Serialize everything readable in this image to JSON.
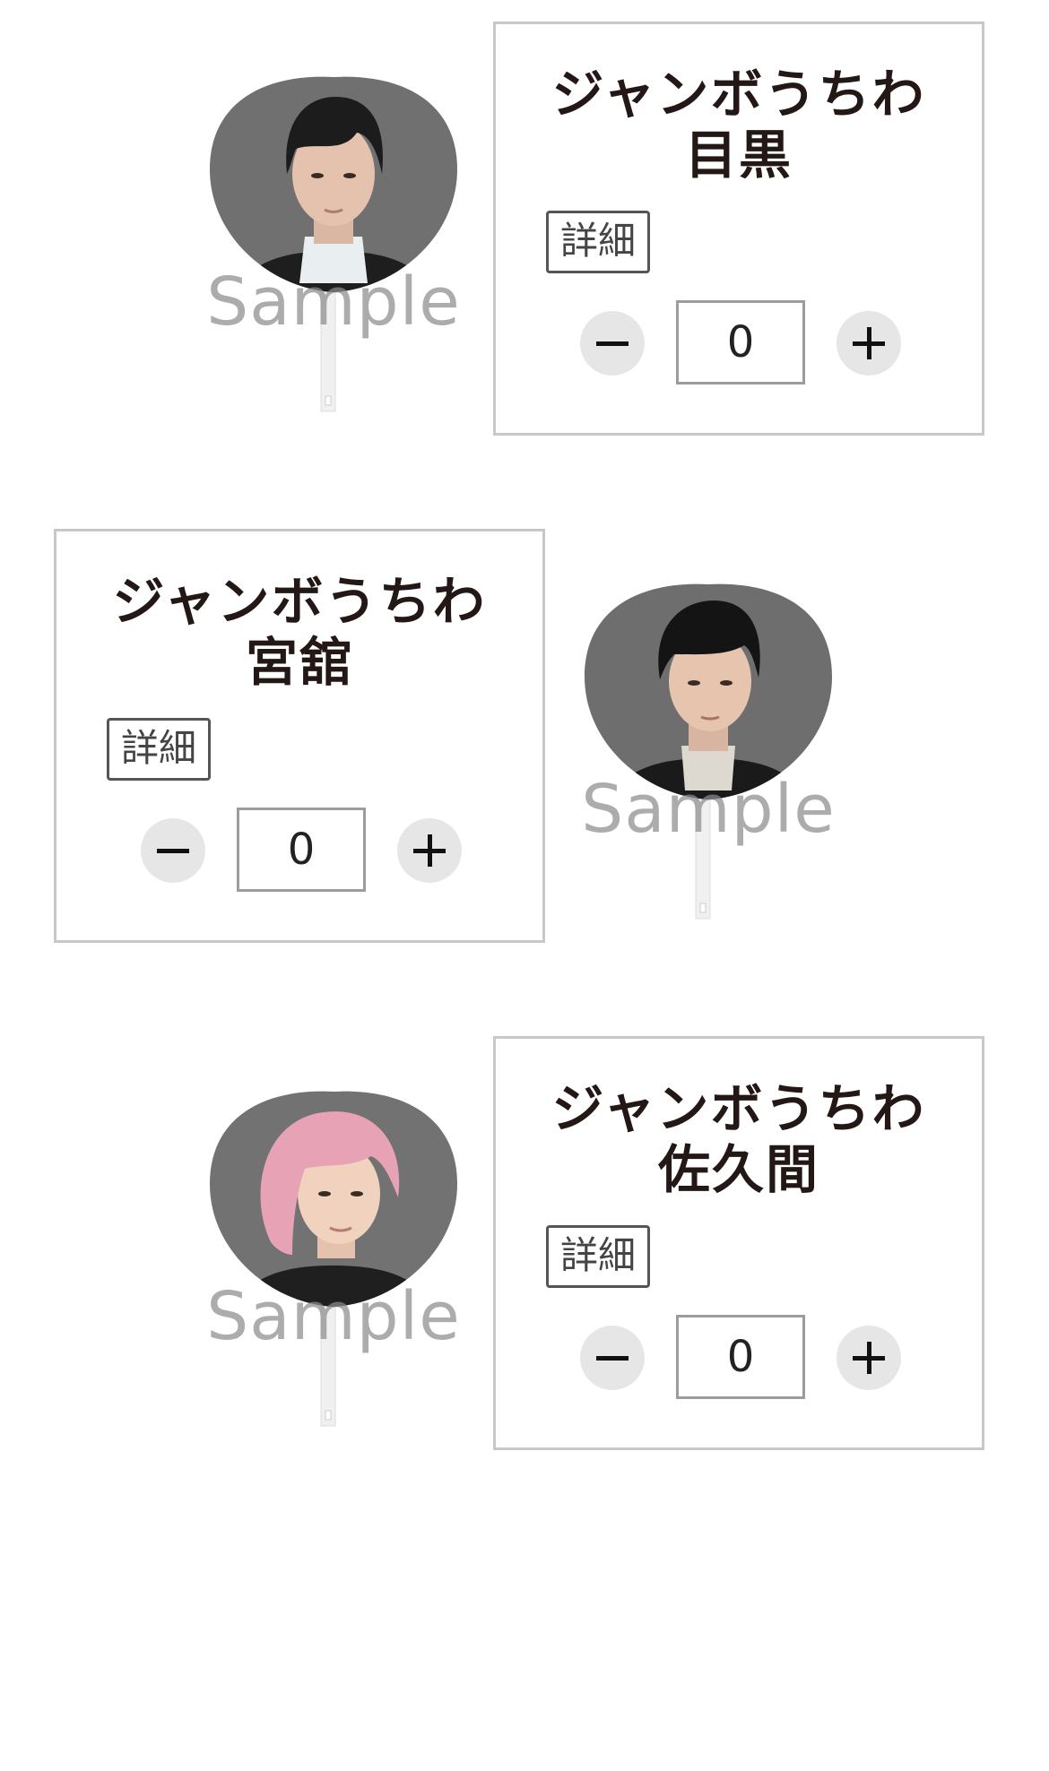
{
  "products": [
    {
      "title_line1": "ジャンボうちわ",
      "title_line2": "目黒",
      "detail_label": "詳細",
      "quantity": "0",
      "watermark": "Sample",
      "hair_color": "#1c1c1c"
    },
    {
      "title_line1": "ジャンボうちわ",
      "title_line2": "宮舘",
      "detail_label": "詳細",
      "quantity": "0",
      "watermark": "Sample",
      "hair_color": "#141414"
    },
    {
      "title_line1": "ジャンボうちわ",
      "title_line2": "佐久間",
      "detail_label": "詳細",
      "quantity": "0",
      "watermark": "Sample",
      "hair_color": "#e8a2b6"
    }
  ],
  "colors": {
    "card_border": "#c8c8c8",
    "stepper_bg": "#e6e6e6",
    "uchiwa_bg": "#6f6f6f",
    "text": "#231815"
  },
  "icons": {
    "minus": "minus-icon",
    "plus": "plus-icon"
  }
}
